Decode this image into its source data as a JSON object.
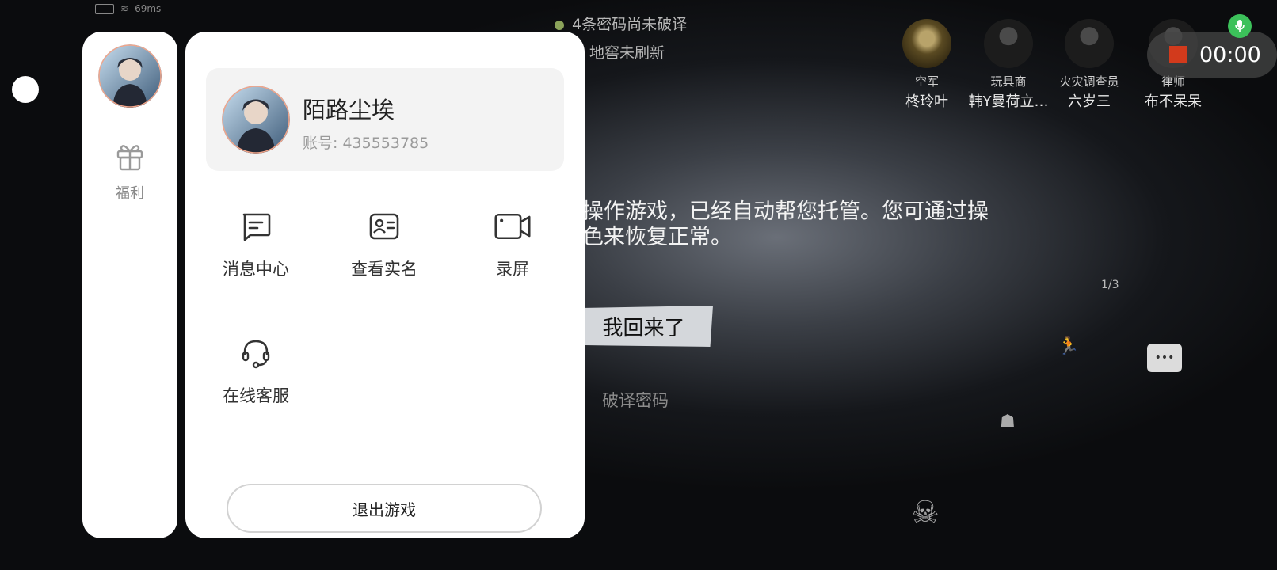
{
  "status_bar": {
    "signal": "69ms"
  },
  "hud": {
    "cipher_line": "4条密码尚未破译",
    "dungeon_line": "地窖未刷新"
  },
  "team": [
    {
      "role": "空军",
      "name": "柊玲叶"
    },
    {
      "role": "玩具商",
      "name": "韩Y曼荷立…"
    },
    {
      "role": "火灾调查员",
      "name": "六岁三"
    },
    {
      "role": "律师",
      "name": "布不呆呆"
    }
  ],
  "game": {
    "message_line1": "操作游戏，已经自动帮您托管。您可通过操",
    "message_line2": "色来恢复正常。",
    "return_button": "我回来了",
    "crack_button": "破译密码",
    "page_indicator": "1/3"
  },
  "recording": {
    "time": "00:00",
    "accent": "#d23a1c",
    "mic_color": "#3cc15a"
  },
  "side_panel": {
    "gift_label": "福利"
  },
  "profile": {
    "name": "陌路尘埃",
    "account": "账号: 435553785"
  },
  "menu": [
    {
      "label": "消息中心",
      "icon": "message-icon"
    },
    {
      "label": "查看实名",
      "icon": "id-card-icon"
    },
    {
      "label": "录屏",
      "icon": "video-icon"
    },
    {
      "label": "在线客服",
      "icon": "headset-icon"
    }
  ],
  "exit_button": "退出游戏"
}
